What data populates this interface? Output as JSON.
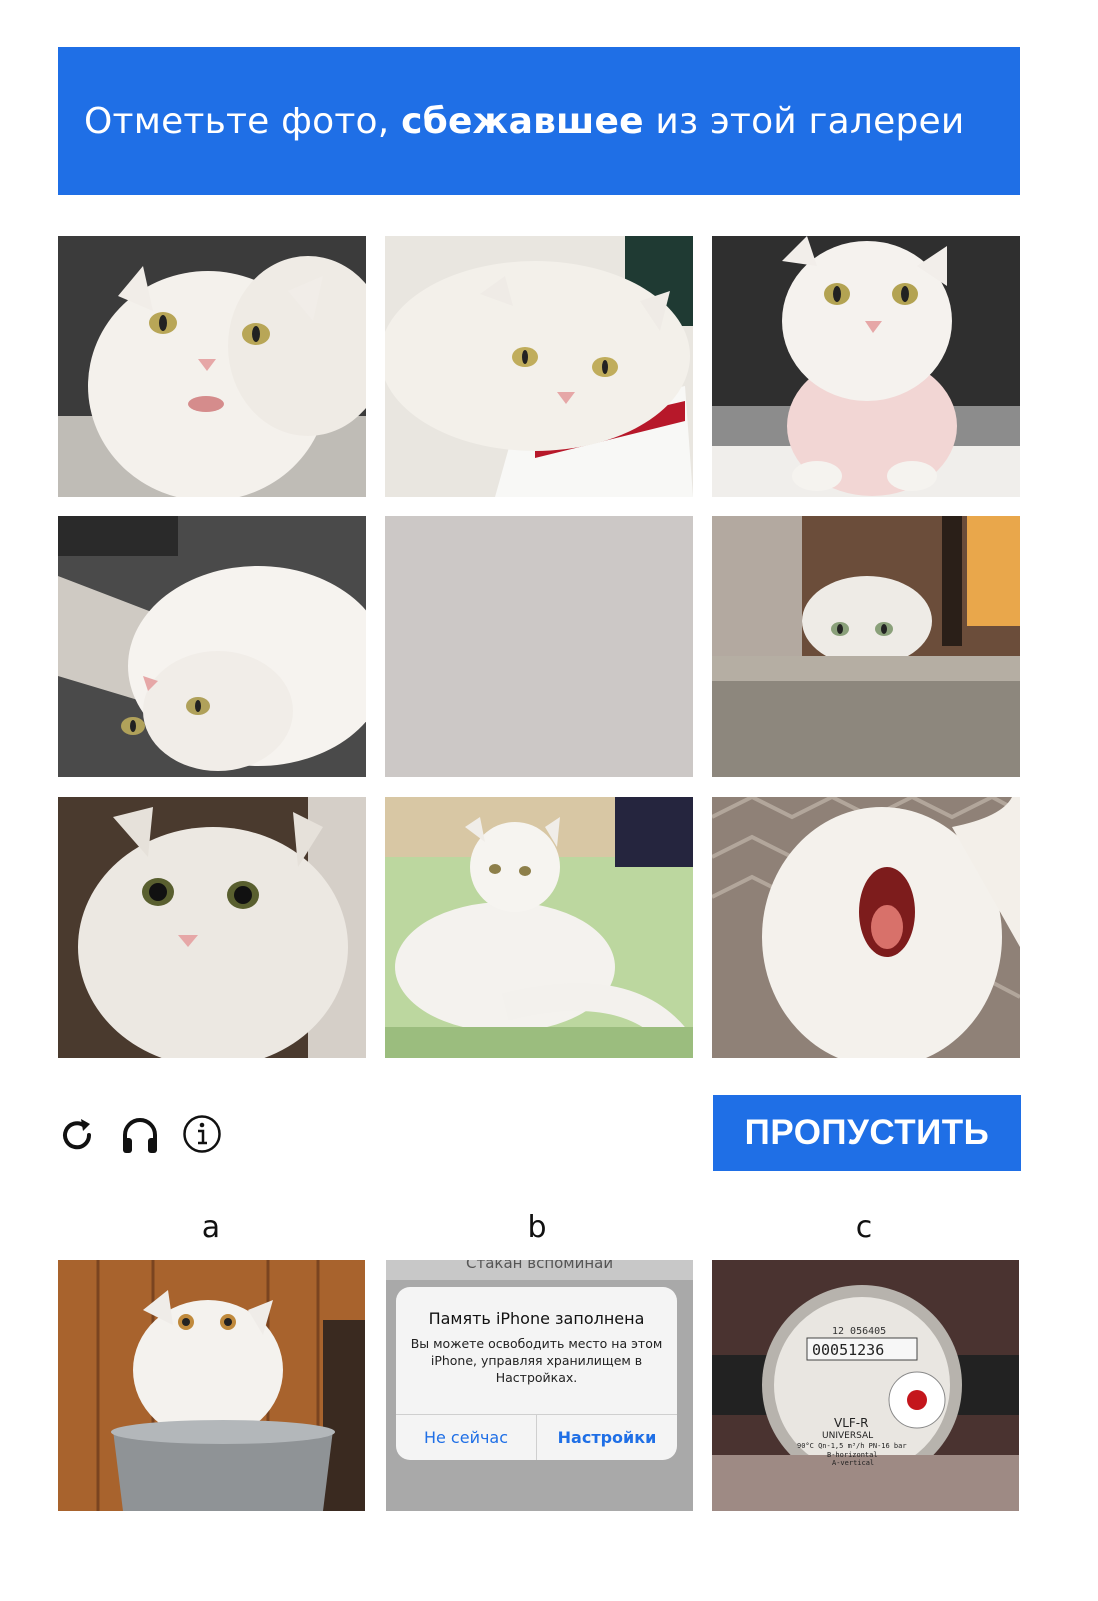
{
  "header": {
    "prefix": "Отметьте фото, ",
    "emphasis": "сбежавшее",
    "suffix": " из этой галереи"
  },
  "grid": {
    "tiles": [
      {
        "icon": "white-cat-closeup-photo",
        "empty": false
      },
      {
        "icon": "white-cat-on-papers-photo",
        "empty": false
      },
      {
        "icon": "white-cat-sitting-photo",
        "empty": false
      },
      {
        "icon": "white-cat-upside-down-photo",
        "empty": false
      },
      {
        "icon": "empty-slot",
        "empty": true
      },
      {
        "icon": "white-cat-peeking-photo",
        "empty": false
      },
      {
        "icon": "white-cat-portrait-photo",
        "empty": false
      },
      {
        "icon": "white-cat-on-bed-photo",
        "empty": false
      },
      {
        "icon": "white-cat-yawning-photo",
        "empty": false
      }
    ]
  },
  "toolbar": {
    "icons": [
      "refresh-icon",
      "headphones-icon",
      "info-icon"
    ],
    "skip_label": "ПРОПУСТИТЬ"
  },
  "options": [
    {
      "label": "a",
      "icon": "white-cat-in-bucket-photo"
    },
    {
      "label": "b",
      "icon": "iphone-storage-alert-screenshot",
      "top_text": "Стакан вспоминай",
      "dialog_title": "Память iPhone заполнена",
      "dialog_message": "Вы можете освободить место на этом iPhone, управляя хранилищем в Настройках.",
      "button_left": "Не сейчас",
      "button_right": "Настройки"
    },
    {
      "label": "c",
      "icon": "water-meter-photo",
      "meter_serial": "12 056405",
      "meter_digits": "00051236",
      "meter_model": "VLF-R",
      "meter_brand": "UNIVERSAL",
      "meter_spec": "90°C Qn-1,5 m³/h PN-16 bar",
      "meter_spec2": "B-horizontal",
      "meter_spec3": "A-vertical"
    }
  ],
  "colors": {
    "accent": "#1f6fe6",
    "empty_tile": "#ccc8c6"
  }
}
